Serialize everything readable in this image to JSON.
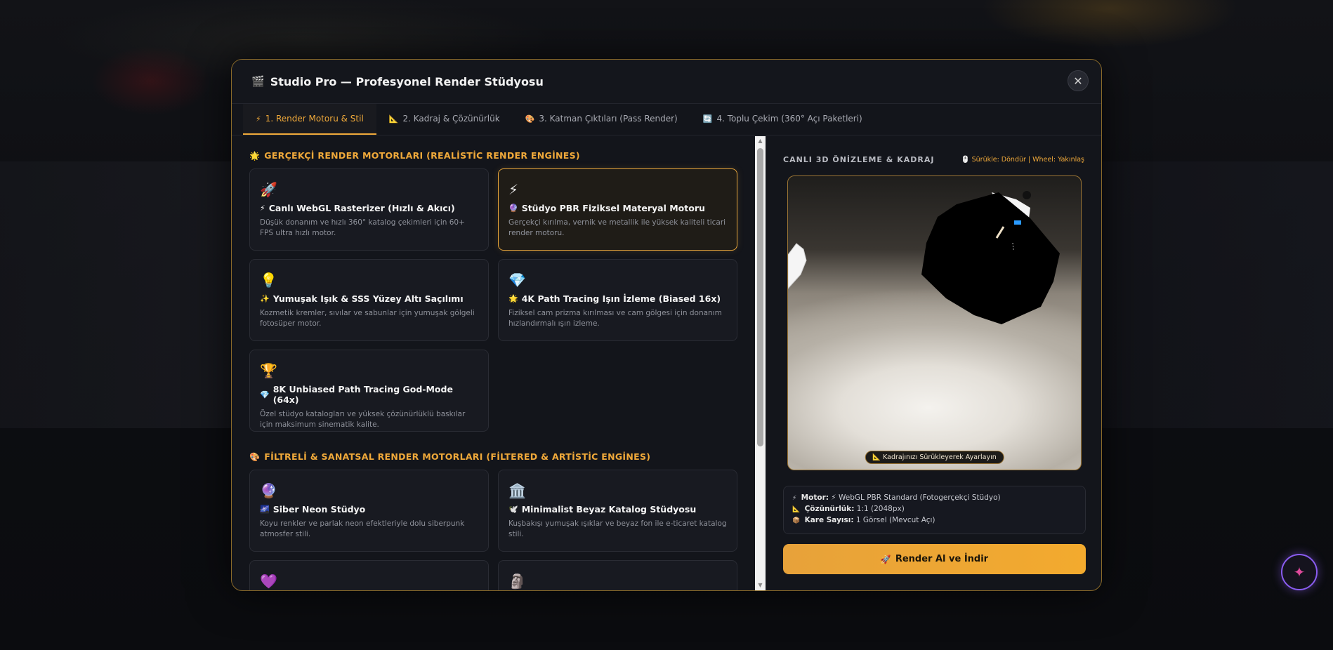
{
  "modal": {
    "icon": "🎬",
    "title": "Studio Pro — Profesyonel Render Stüdyosu",
    "close_icon": "✕"
  },
  "tabs": [
    {
      "icon": "⚡",
      "label": "1. Render Motoru & Stil",
      "active": true
    },
    {
      "icon": "📐",
      "label": "2. Kadraj & Çözünürlük",
      "active": false
    },
    {
      "icon": "🎨",
      "label": "3. Katman Çıktıları (Pass Render)",
      "active": false
    },
    {
      "icon": "🔄",
      "label": "4. Toplu Çekim (360° Açı Paketleri)",
      "active": false
    }
  ],
  "realistic": {
    "icon": "🌟",
    "title": "GERÇEKÇİ RENDER MOTORLARI (REALİSTİC RENDER ENGİNES)",
    "cards": [
      {
        "icon": "🚀",
        "title_icon": "⚡",
        "title": "Canlı WebGL Rasterizer (Hızlı & Akıcı)",
        "desc": "Düşük donanım ve hızlı 360° katalog çekimleri için 60+ FPS ultra hızlı motor.",
        "selected": false
      },
      {
        "icon": "⚡",
        "title_icon": "🔮",
        "title": "Stüdyo PBR Fiziksel Materyal Motoru",
        "desc": "Gerçekçi kırılma, vernik ve metallik ile yüksek kaliteli ticari render motoru.",
        "selected": true
      },
      {
        "icon": "💡",
        "title_icon": "✨",
        "title": "Yumuşak Işık & SSS Yüzey Altı Saçılımı",
        "desc": "Kozmetik kremler, sıvılar ve sabunlar için yumuşak gölgeli fotosüper motor.",
        "selected": false
      },
      {
        "icon": "💎",
        "title_icon": "🌟",
        "title": "4K Path Tracing Işın İzleme (Biased 16x)",
        "desc": "Fiziksel cam prizma kırılması ve cam gölgesi için donanım hızlandırmalı ışın izleme.",
        "selected": false
      },
      {
        "icon": "🏆",
        "title_icon": "💎",
        "title": "8K Unbiased Path Tracing God-Mode (64x)",
        "desc": "Özel stüdyo katalogları ve yüksek çözünürlüklü baskılar için maksimum sinematik kalite.",
        "selected": false
      }
    ]
  },
  "artistic": {
    "icon": "🎨",
    "title": "FİLTRELİ & SANATSAL RENDER MOTORLARI (FİLTERED & ARTİSTİC ENGİNES)",
    "cards": [
      {
        "icon": "🔮",
        "title_icon": "🌌",
        "title": "Siber Neon Stüdyo",
        "desc": "Koyu renkler ve parlak neon efektleriyle dolu siberpunk atmosfer stili.",
        "selected": false
      },
      {
        "icon": "🏛️",
        "title_icon": "🕊️",
        "title": "Minimalist Beyaz Katalog Stüdyosu",
        "desc": "Kuşbakışı yumuşak ışıklar ve beyaz fon ile e-ticaret katalog stili.",
        "selected": false
      },
      {
        "icon": "💜",
        "title_icon": "",
        "title": "",
        "desc": "",
        "selected": false
      },
      {
        "icon": "🗿",
        "title_icon": "",
        "title": "",
        "desc": "",
        "selected": false
      }
    ]
  },
  "preview": {
    "title": "CANLI 3D ÖNİZLEME & KADRAJ",
    "hint": "🖱️ Sürükle: Döndür | Wheel: Yakınlaş",
    "badge": "📐 Kadrajınızı Sürükleyerek Ayarlayın"
  },
  "info": {
    "motor_label": "Motor:",
    "motor_icon": "⚡",
    "motor_value": "⚡ WebGL PBR Standard (Fotogerçekçi Stüdyo)",
    "res_icon": "📐",
    "res_label": "Çözünürlük:",
    "res_value": "1:1 (2048px)",
    "frames_icon": "📦",
    "frames_label": "Kare Sayısı:",
    "frames_value": "1 Görsel (Mevcut Açı)"
  },
  "render_button": {
    "icon": "🚀",
    "label": "Render Al ve İndir"
  },
  "fab": {
    "icon": "✦"
  }
}
